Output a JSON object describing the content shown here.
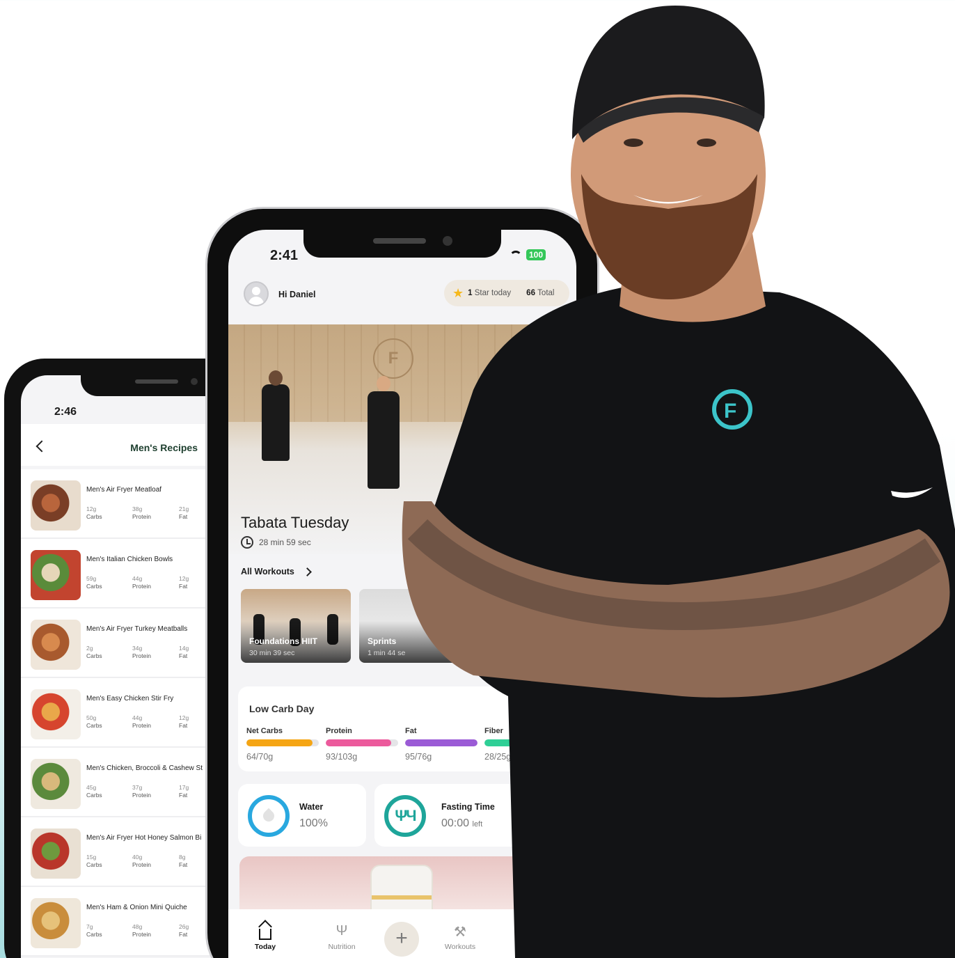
{
  "left_phone": {
    "time": "2:46",
    "title": "Men's Recipes",
    "recipes": [
      {
        "name": "Men's Air Fryer Meatloaf",
        "carbs": "12g",
        "protein": "38g",
        "fat": "21g"
      },
      {
        "name": "Men's Italian Chicken Bowls",
        "carbs": "59g",
        "protein": "44g",
        "fat": "12g"
      },
      {
        "name": "Men's Air Fryer Turkey Meatballs",
        "carbs": "2g",
        "protein": "34g",
        "fat": "14g"
      },
      {
        "name": "Men's Easy Chicken Stir Fry",
        "carbs": "50g",
        "protein": "44g",
        "fat": "12g"
      },
      {
        "name": "Men's Chicken, Broccoli & Cashew St",
        "carbs": "45g",
        "protein": "37g",
        "fat": "17g"
      },
      {
        "name": "Men's Air Fryer Hot Honey Salmon Bi",
        "carbs": "15g",
        "protein": "40g",
        "fat": "8g"
      },
      {
        "name": "Men's Ham & Onion Mini Quiche",
        "carbs": "7g",
        "protein": "48g",
        "fat": "26g"
      }
    ],
    "labels": {
      "carbs": "Carbs",
      "protein": "Protein",
      "fat": "Fat"
    }
  },
  "center_phone": {
    "time": "2:41",
    "battery": "100",
    "greeting": "Hi Daniel",
    "stars_today_count": "1",
    "stars_today_label": "Star today",
    "stars_total_count": "66",
    "stars_total_label": "Total",
    "hero": {
      "title": "Tabata Tuesday",
      "duration": "28 min 59 sec"
    },
    "all_workouts": "All Workouts",
    "workouts": [
      {
        "name": "Foundations HIIT",
        "duration": "30 min 39 sec"
      },
      {
        "name": "Sprints",
        "duration": "1 min 44 se"
      }
    ],
    "day": {
      "title": "Low Carb Day",
      "macros": [
        {
          "name": "Net Carbs",
          "value": "64/70g",
          "fill": 0.91,
          "color": "#f5a514"
        },
        {
          "name": "Protein",
          "value": "93/103g",
          "fill": 0.9,
          "color": "#ec5a9c"
        },
        {
          "name": "Fat",
          "value": "95/76g",
          "fill": 1.0,
          "color": "#9b5bd6"
        },
        {
          "name": "Fiber",
          "value": "28/25g",
          "fill": 1.0,
          "color": "#2fcf96"
        }
      ]
    },
    "water": {
      "label": "Water",
      "value": "100%"
    },
    "fasting": {
      "label": "Fasting Time",
      "value": "00:00",
      "suffix": "left"
    },
    "tabs": [
      "Today",
      "Nutrition",
      "Workouts"
    ]
  }
}
